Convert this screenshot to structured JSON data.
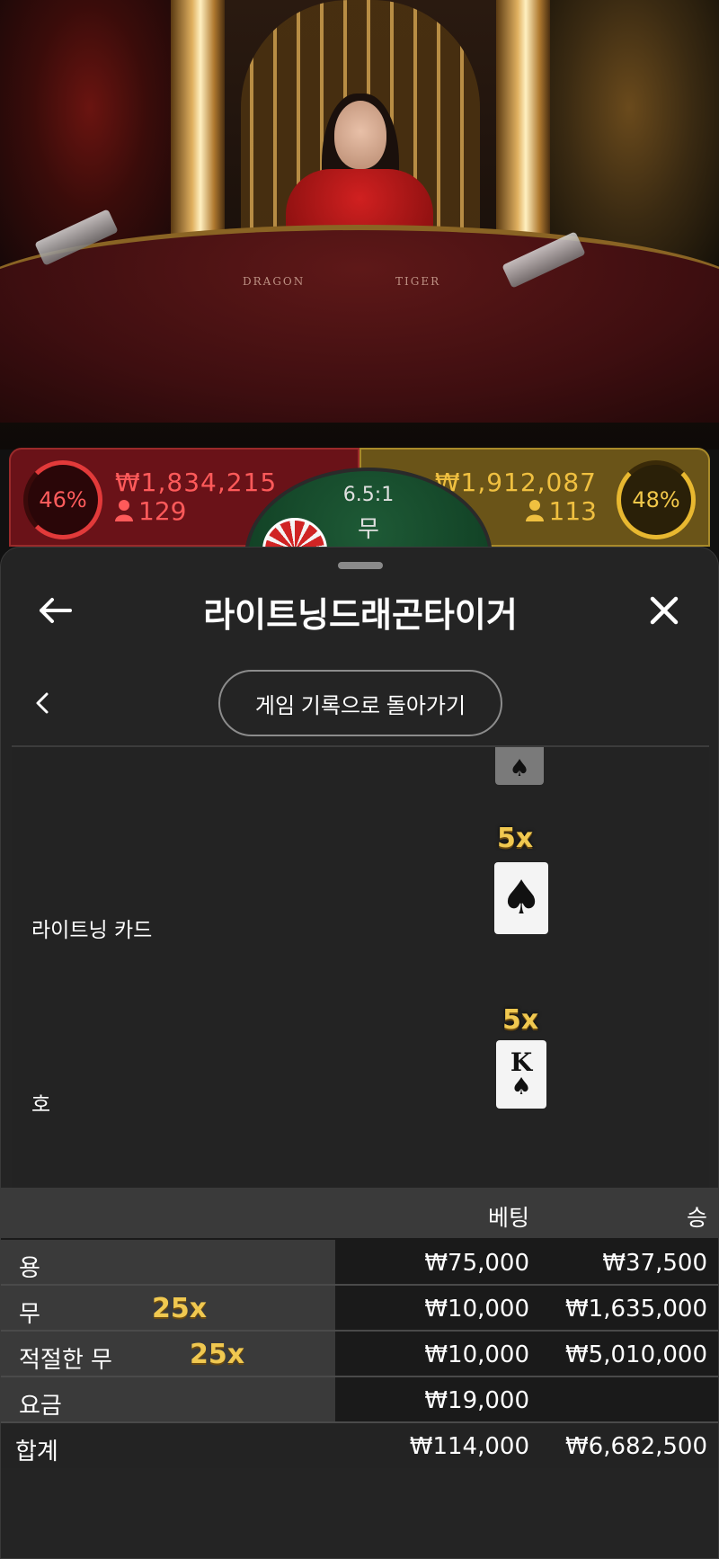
{
  "scene": {
    "table_left": "DRAGON",
    "table_right": "TIGER"
  },
  "bet_strip": {
    "dragon": {
      "percent": "46%",
      "amount": "₩1,834,215",
      "players": "129"
    },
    "tiger": {
      "percent": "48%",
      "amount": "₩1,912,087",
      "players": "113"
    },
    "tie": {
      "odds": "6.5:1",
      "label": "무"
    }
  },
  "sheet": {
    "title": "라이트닝드래곤타이거",
    "history_button": "게임 기록으로 돌아가기",
    "details": [
      {
        "label": "라이트닝 카드",
        "multiplier": "5x",
        "card_rank": "",
        "card_suit": "♠"
      },
      {
        "label": "호",
        "multiplier": "5x",
        "card_rank": "K",
        "card_suit": "♠"
      }
    ],
    "table": {
      "col_bet": "베팅",
      "col_win": "승",
      "rows": [
        {
          "name": "용",
          "mult": "",
          "bet": "₩75,000",
          "win": "₩37,500"
        },
        {
          "name": "무",
          "mult": "25x",
          "bet": "₩10,000",
          "win": "₩1,635,000"
        },
        {
          "name": "적절한 무",
          "mult": "25x",
          "bet": "₩10,000",
          "win": "₩5,010,000"
        },
        {
          "name": "요금",
          "mult": "",
          "bet": "₩19,000",
          "win": ""
        }
      ],
      "total": {
        "name": "합계",
        "bet": "₩114,000",
        "win": "₩6,682,500"
      }
    }
  },
  "colors": {
    "dragon": "#ff5a5a",
    "tiger": "#f0c040",
    "multiplier_gold": "#f0c850",
    "sheet_bg": "#242424"
  }
}
